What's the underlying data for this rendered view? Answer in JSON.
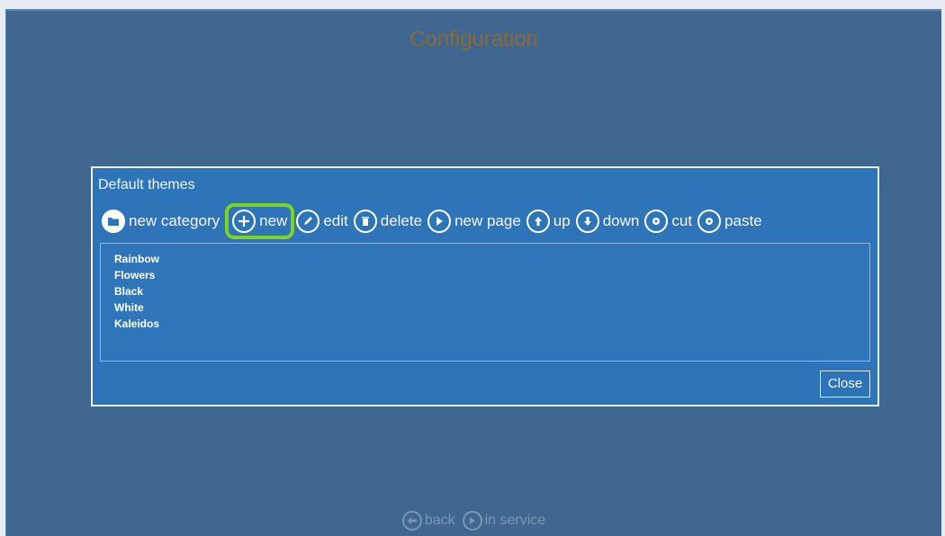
{
  "page": {
    "title": "Configuration"
  },
  "dialog": {
    "title": "Default themes",
    "toolbar": [
      {
        "name": "new-category-button",
        "icon": "folder-icon",
        "label": "new category"
      },
      {
        "name": "new-button",
        "icon": "plus-circle-icon",
        "label": "new",
        "highlight": true
      },
      {
        "name": "edit-button",
        "icon": "pencil-icon",
        "label": "edit"
      },
      {
        "name": "delete-button",
        "icon": "trash-icon",
        "label": "delete"
      },
      {
        "name": "new-page-button",
        "icon": "play-icon",
        "label": "new page"
      },
      {
        "name": "up-button",
        "icon": "arrow-up-icon",
        "label": "up"
      },
      {
        "name": "down-button",
        "icon": "arrow-down-icon",
        "label": "down"
      },
      {
        "name": "cut-button",
        "icon": "gear-icon",
        "label": "cut"
      },
      {
        "name": "paste-button",
        "icon": "gear-icon",
        "label": "paste"
      }
    ],
    "items": [
      "Rainbow",
      "Flowers",
      "Black",
      "White",
      "Kaleidos"
    ],
    "close_label": "Close"
  },
  "bottom": {
    "back_label": "back",
    "in_service_label": "in service"
  },
  "colors": {
    "background": "#3f678f",
    "dialog": "#2e74b8",
    "highlight": "#7ed321",
    "title_text": "#8a6a36"
  }
}
